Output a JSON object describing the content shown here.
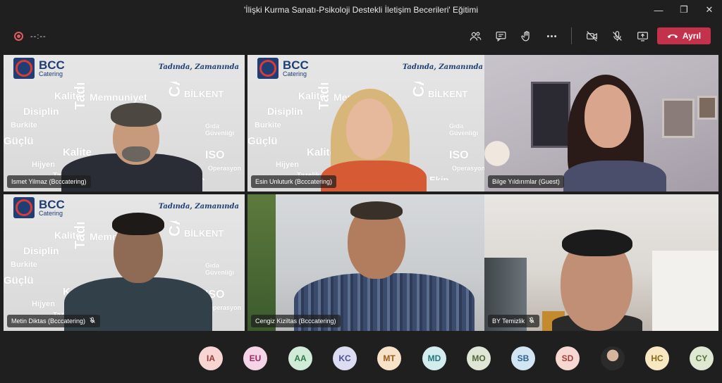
{
  "window": {
    "title": "'İlişki Kurma Sanatı-Psikoloji Destekli İletişim Becerileri' Eğitimi",
    "minimize": "—",
    "maximize": "❐",
    "close": "✕"
  },
  "toolbar": {
    "recording_timer": "--:--",
    "leave_label": "Ayrıl",
    "tools": [
      {
        "icon": "participants-icon"
      },
      {
        "icon": "chat-icon"
      },
      {
        "icon": "raise-hand-icon"
      },
      {
        "icon": "more-actions-icon"
      },
      {
        "icon": "camera-off-icon"
      },
      {
        "icon": "mic-off-icon"
      },
      {
        "icon": "share-screen-icon"
      }
    ],
    "leave_color": "#c4314b"
  },
  "brand": {
    "logo_name": "BCC",
    "logo_sub": "Catering",
    "slogan": "Tadında, Zamanında"
  },
  "tiles": [
    {
      "name": "Ismet Yilmaz (Bcccatering)",
      "muted": false
    },
    {
      "name": "Esin Unluturk (Bcccatering)",
      "muted": false
    },
    {
      "name": "Bilge Yıldırımlar (Guest)",
      "muted": false
    },
    {
      "name": "Metin Diktas (Bcccatering)",
      "muted": true
    },
    {
      "name": "Cengiz Kiziltas (Bcccatering)",
      "muted": false
    },
    {
      "name": "BY Temizlik",
      "muted": true
    }
  ],
  "participants": [
    {
      "initials": "IA",
      "bg": "#f6d5d2",
      "fg": "#a0363b"
    },
    {
      "initials": "EU",
      "bg": "#f4d4e6",
      "fg": "#9b2a63"
    },
    {
      "initials": "AA",
      "bg": "#d0ecd9",
      "fg": "#2f7a4a"
    },
    {
      "initials": "KC",
      "bg": "#dcdcf2",
      "fg": "#4f4f96"
    },
    {
      "initials": "MT",
      "bg": "#f8e1c9",
      "fg": "#9c5a1d"
    },
    {
      "initials": "MD",
      "bg": "#d3ecee",
      "fg": "#26767d"
    },
    {
      "initials": "MO",
      "bg": "#dfe6d5",
      "fg": "#54683a"
    },
    {
      "initials": "SB",
      "bg": "#d2e5f2",
      "fg": "#2c6590"
    },
    {
      "initials": "SD",
      "bg": "#f6d7d2",
      "fg": "#a3423a"
    },
    {
      "initials": "",
      "bg": "photo",
      "fg": ""
    },
    {
      "initials": "HC",
      "bg": "#f7e7c2",
      "fg": "#8c6a16"
    },
    {
      "initials": "CY",
      "bg": "#dfe8d2",
      "fg": "#56703a"
    }
  ]
}
